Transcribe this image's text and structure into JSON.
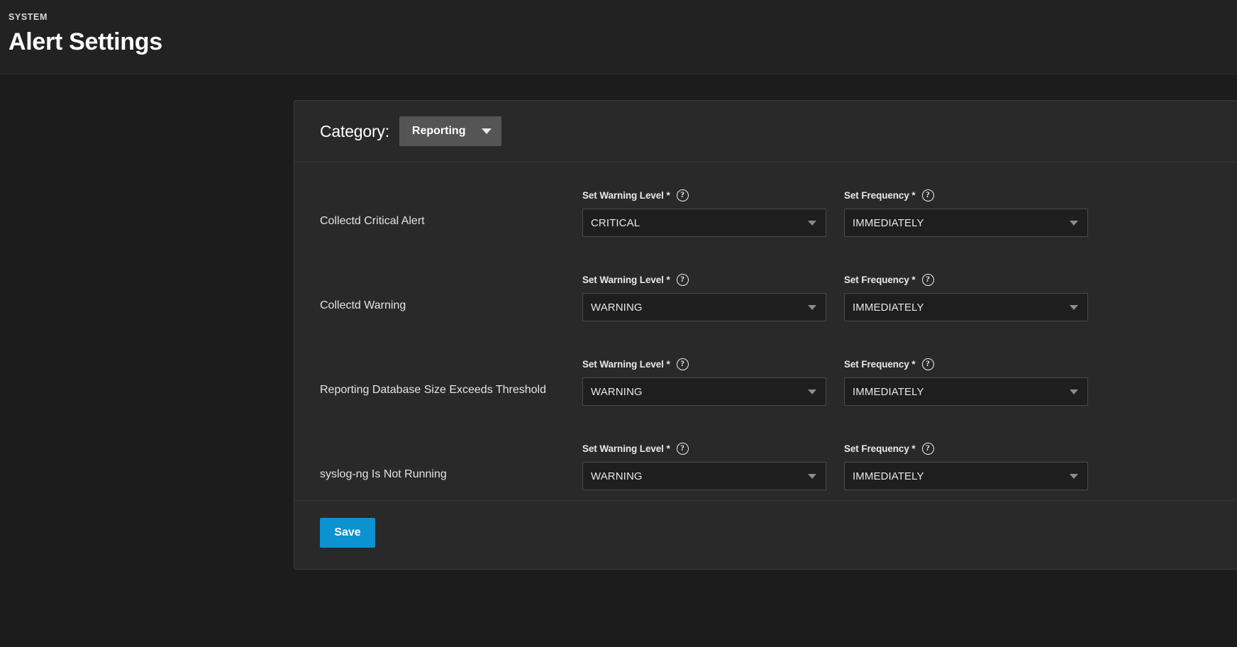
{
  "header": {
    "eyebrow": "SYSTEM",
    "title": "Alert Settings"
  },
  "category": {
    "label": "Category:",
    "selected": "Reporting",
    "caret_icon": "chevron-down-icon"
  },
  "columns": {
    "warning_level_label": "Set Warning Level *",
    "frequency_label": "Set Frequency *",
    "help_icon": "help-circle-icon",
    "help_glyph": "?"
  },
  "alerts": [
    {
      "name": "Collectd Critical Alert",
      "warning_level": "CRITICAL",
      "frequency": "IMMEDIATELY"
    },
    {
      "name": "Collectd Warning",
      "warning_level": "WARNING",
      "frequency": "IMMEDIATELY"
    },
    {
      "name": "Reporting Database Size Exceeds Threshold",
      "warning_level": "WARNING",
      "frequency": "IMMEDIATELY"
    },
    {
      "name": "syslog-ng Is Not Running",
      "warning_level": "WARNING",
      "frequency": "IMMEDIATELY"
    }
  ],
  "footer": {
    "save_label": "Save"
  },
  "colors": {
    "accent": "#0d92d1",
    "page_background": "#1c1c1c",
    "panel_background": "#292929",
    "header_background": "#222222",
    "field_background": "#1e1e1e"
  }
}
